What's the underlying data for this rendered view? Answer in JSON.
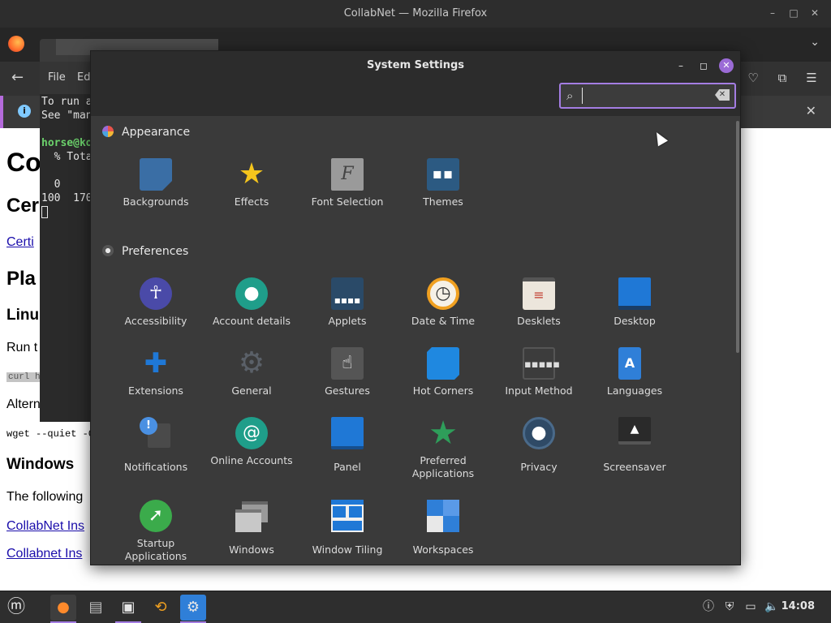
{
  "firefox": {
    "window_title": "CollabNet — Mozilla Firefox",
    "page": {
      "h1": "Co",
      "h2_cert": "Cer",
      "link_cert": "Certi",
      "h2_plat": "Pla",
      "h3_linux": "Linu",
      "p_run": "Run t",
      "code_curl": "curl h",
      "p_alt": "Altern",
      "code_wget": "wget --quiet -O",
      "h3_windows": "Windows",
      "p_following": "The following",
      "link_install1": "CollabNet Ins",
      "link_install2": "Collabnet Ins"
    }
  },
  "terminal": {
    "menu": [
      "File",
      "Ed"
    ],
    "lines": [
      "To run a",
      "See \"man",
      "",
      "  % Tota",
      "",
      "  0",
      "100  170"
    ],
    "prompt": "horse@ko"
  },
  "settings": {
    "title": "System Settings",
    "search": {
      "value": "",
      "placeholder": ""
    },
    "sections": [
      {
        "name": "Appearance",
        "items": [
          {
            "label": "Backgrounds",
            "icon": "backgrounds-icon"
          },
          {
            "label": "Effects",
            "icon": "effects-icon"
          },
          {
            "label": "Font Selection",
            "icon": "font-selection-icon"
          },
          {
            "label": "Themes",
            "icon": "themes-icon"
          }
        ]
      },
      {
        "name": "Preferences",
        "items": [
          {
            "label": "Accessibility",
            "icon": "accessibility-icon"
          },
          {
            "label": "Account details",
            "icon": "account-details-icon"
          },
          {
            "label": "Applets",
            "icon": "applets-icon"
          },
          {
            "label": "Date & Time",
            "icon": "date-time-icon"
          },
          {
            "label": "Desklets",
            "icon": "desklets-icon"
          },
          {
            "label": "Desktop",
            "icon": "desktop-icon"
          },
          {
            "label": "Extensions",
            "icon": "extensions-icon"
          },
          {
            "label": "General",
            "icon": "general-icon"
          },
          {
            "label": "Gestures",
            "icon": "gestures-icon"
          },
          {
            "label": "Hot Corners",
            "icon": "hot-corners-icon"
          },
          {
            "label": "Input Method",
            "icon": "input-method-icon"
          },
          {
            "label": "Languages",
            "icon": "languages-icon"
          },
          {
            "label": "Notifications",
            "icon": "notifications-icon"
          },
          {
            "label": "Online Accounts",
            "icon": "online-accounts-icon"
          },
          {
            "label": "Panel",
            "icon": "panel-icon"
          },
          {
            "label": "Preferred Applications",
            "icon": "preferred-applications-icon"
          },
          {
            "label": "Privacy",
            "icon": "privacy-icon"
          },
          {
            "label": "Screensaver",
            "icon": "screensaver-icon"
          },
          {
            "label": "Startup Applications",
            "icon": "startup-applications-icon"
          },
          {
            "label": "Windows",
            "icon": "windows-icon"
          },
          {
            "label": "Window Tiling",
            "icon": "window-tiling-icon"
          },
          {
            "label": "Workspaces",
            "icon": "workspaces-icon"
          }
        ]
      }
    ]
  },
  "taskbar": {
    "clock": "14:08",
    "apps": [
      "menu-icon",
      "firefox-icon",
      "files-icon",
      "terminal-icon",
      "updater-icon",
      "system-settings-icon"
    ]
  },
  "colors": {
    "accent": "#a47de3",
    "window_bg": "#3a3a3a",
    "header_bg": "#2c2c2c"
  }
}
